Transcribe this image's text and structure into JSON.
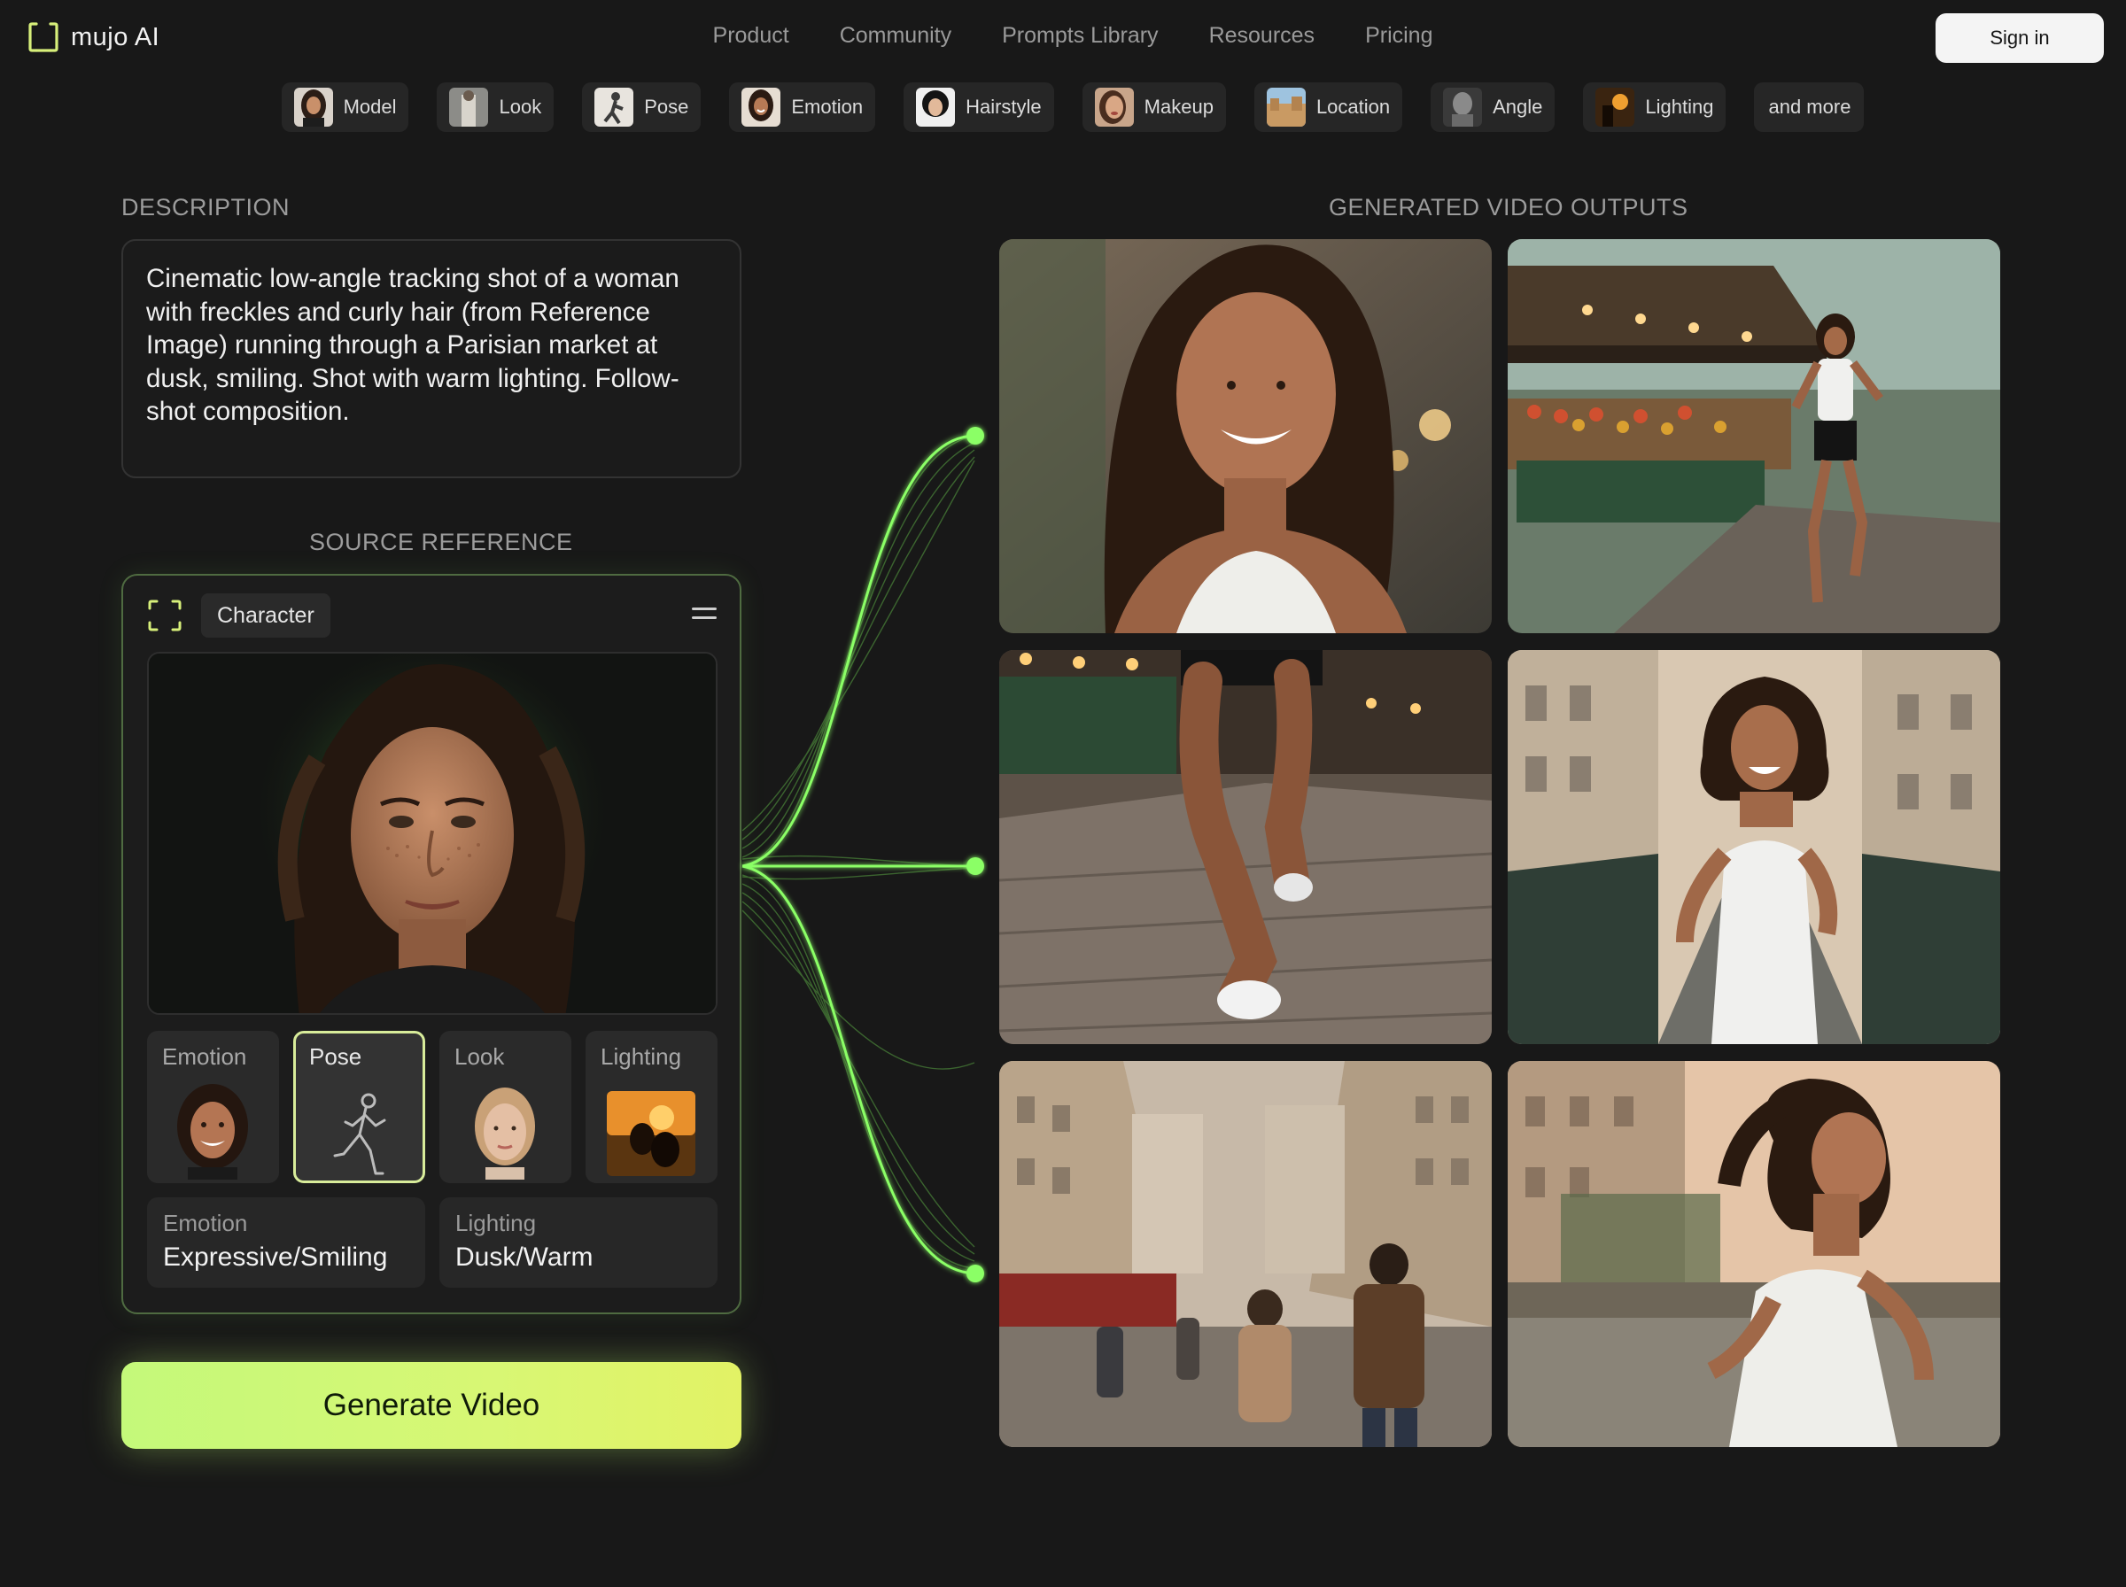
{
  "brand": {
    "name": "mujo AI"
  },
  "nav": [
    "Product",
    "Community",
    "Prompts Library",
    "Resources",
    "Pricing"
  ],
  "header": {
    "sign_in": "Sign in"
  },
  "chips": [
    {
      "label": "Model",
      "thumb": "portrait"
    },
    {
      "label": "Look",
      "thumb": "fashion"
    },
    {
      "label": "Pose",
      "thumb": "pose"
    },
    {
      "label": "Emotion",
      "thumb": "portrait"
    },
    {
      "label": "Hairstyle",
      "thumb": "hairstyle"
    },
    {
      "label": "Makeup",
      "thumb": "portrait"
    },
    {
      "label": "Location",
      "thumb": "city"
    },
    {
      "label": "Angle",
      "thumb": "statue"
    },
    {
      "label": "Lighting",
      "thumb": "sunset"
    },
    {
      "label": "and more",
      "thumb": null
    }
  ],
  "description": {
    "label": "DESCRIPTION",
    "text": "Cinematic low-angle tracking shot of a woman with freckles and curly hair (from Reference Image) running through a Parisian market at dusk, smiling. Shot with warm lighting. Follow-shot composition."
  },
  "source": {
    "label": "SOURCE REFERENCE",
    "chip": "Character",
    "tiles": [
      {
        "label": "Emotion",
        "selected": false
      },
      {
        "label": "Pose",
        "selected": true
      },
      {
        "label": "Look",
        "selected": false
      },
      {
        "label": "Lighting",
        "selected": false
      }
    ],
    "info": [
      {
        "key": "Emotion",
        "value": "Expressive/Smiling"
      },
      {
        "key": "Lighting",
        "value": "Dusk/Warm"
      }
    ]
  },
  "generate_label": "Generate Video",
  "outputs": {
    "label": "GENERATED VIDEO OUTPUTS",
    "frames": [
      "smiling-closeup",
      "market-run-wide",
      "running-legs-cobblestone",
      "bridge-run",
      "street-crowd",
      "profile-run-river"
    ]
  },
  "colors": {
    "accent": "#c4f97a",
    "wire": "#7cf25a",
    "bg": "#181818"
  }
}
